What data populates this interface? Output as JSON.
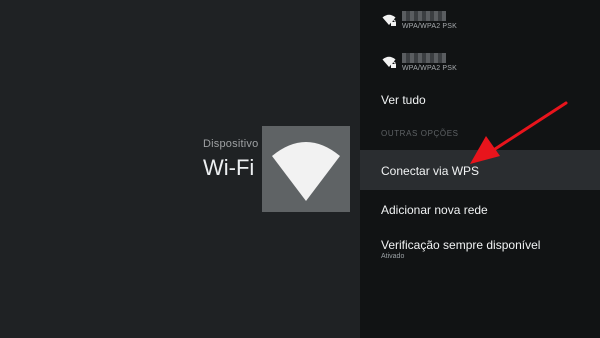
{
  "left": {
    "section_label": "Dispositivo",
    "section_title": "Wi-Fi",
    "tile_icon": "wifi-icon"
  },
  "networks": [
    {
      "name_redacted": true,
      "security": "WPA/WPA2 PSK",
      "icon": "wifi-lock-icon"
    },
    {
      "name_redacted": true,
      "security": "WPA/WPA2 PSK",
      "icon": "wifi-lock-icon"
    }
  ],
  "see_all": "Ver tudo",
  "other_options_header": "OUTRAS OPÇÕES",
  "menu": {
    "wps": "Conectar via WPS",
    "add_network": "Adicionar nova rede",
    "always_scan": "Verificação sempre disponível",
    "always_scan_status": "Ativado"
  },
  "colors": {
    "accent_arrow": "#e8141c",
    "panel_bg": "#111314",
    "background": "#1f2224"
  }
}
